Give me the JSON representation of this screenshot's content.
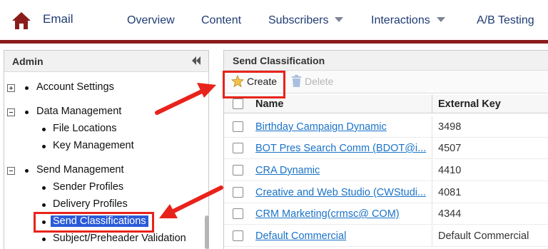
{
  "nav": {
    "app_title": "Email",
    "items": [
      {
        "label": "Overview",
        "has_caret": false
      },
      {
        "label": "Content",
        "has_caret": false
      },
      {
        "label": "Subscribers",
        "has_caret": true
      },
      {
        "label": "Interactions",
        "has_caret": true
      },
      {
        "label": "A/B Testing",
        "has_caret": false
      }
    ],
    "accent_color": "#8a1c1c"
  },
  "admin": {
    "title": "Admin",
    "tree": [
      {
        "label": "Account Settings",
        "level": 0,
        "expander": "plus"
      },
      {
        "label": "Data Management",
        "level": 0,
        "expander": "minus"
      },
      {
        "label": "File Locations",
        "level": 1
      },
      {
        "label": "Key Management",
        "level": 1
      },
      {
        "label": "Send Management",
        "level": 0,
        "expander": "minus"
      },
      {
        "label": "Sender Profiles",
        "level": 1
      },
      {
        "label": "Delivery Profiles",
        "level": 1
      },
      {
        "label": "Send Classifications",
        "level": 1,
        "selected": true
      },
      {
        "label": "Subject/Preheader Validation",
        "level": 1
      }
    ]
  },
  "main": {
    "title": "Send Classification",
    "toolbar": {
      "create_label": "Create",
      "delete_label": "Delete"
    },
    "columns": {
      "name": "Name",
      "external_key": "External Key"
    },
    "rows": [
      {
        "name": "Birthday Campaign Dynamic",
        "key": "3498"
      },
      {
        "name": "BOT Pres Search Comm (BDOT@i...",
        "key": "4507"
      },
      {
        "name": "CRA Dynamic",
        "key": "4410"
      },
      {
        "name": "Creative and Web Studio (CWStudi...",
        "key": "4081"
      },
      {
        "name": "CRM Marketing(crmsc@ COM)",
        "key": "4344"
      },
      {
        "name": "Default Commercial",
        "key": "Default Commercial"
      }
    ]
  },
  "annotation_color": "#e8231b"
}
